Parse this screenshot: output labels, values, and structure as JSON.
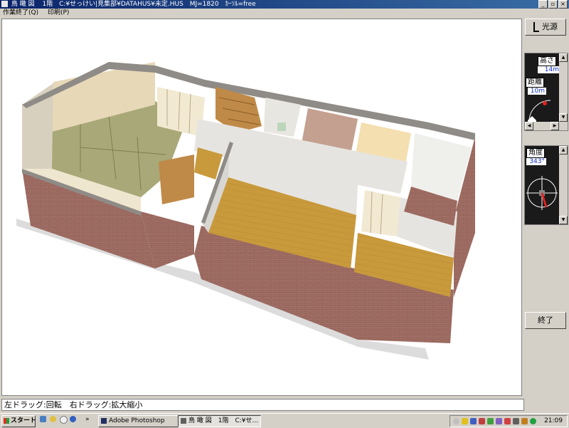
{
  "window": {
    "title_prefix": "鳥 瞰 図",
    "floor": "1階",
    "path": "C:¥せっけい|見集部¥DATAHUS¥未定.HUS",
    "mj": "MJ=1820",
    "cursor": "ｶｰｿﾙ=free"
  },
  "window_buttons": {
    "minimize": "_",
    "restore": "▫",
    "close": "×"
  },
  "menu": {
    "items": [
      "作業終了(Q)",
      "印刷(P)"
    ]
  },
  "side": {
    "light_button": "光源",
    "height_label": "高さ",
    "height_value": "14m",
    "distance_label": "距離",
    "distance_value": "10m",
    "angle_label": "角度",
    "angle_value": "343°",
    "exit_button": "終了"
  },
  "status": {
    "hint": "左ドラッグ:回転　右ドラッグ:拡大縮小"
  },
  "taskbar": {
    "start": "スタート",
    "quick_launch_more": "»",
    "task1": "Adobe Photoshop",
    "task2": "鳥 瞰 図　1階　C:¥せ...",
    "clock": "21:09"
  },
  "colors": {
    "brick": "#a06e64",
    "wall_top": "#8f8b86",
    "wall_inner": "#e6e4e0",
    "wood_floor": "#c89a3c",
    "tatami": "#a8a878",
    "pink_floor": "#c4a090"
  }
}
